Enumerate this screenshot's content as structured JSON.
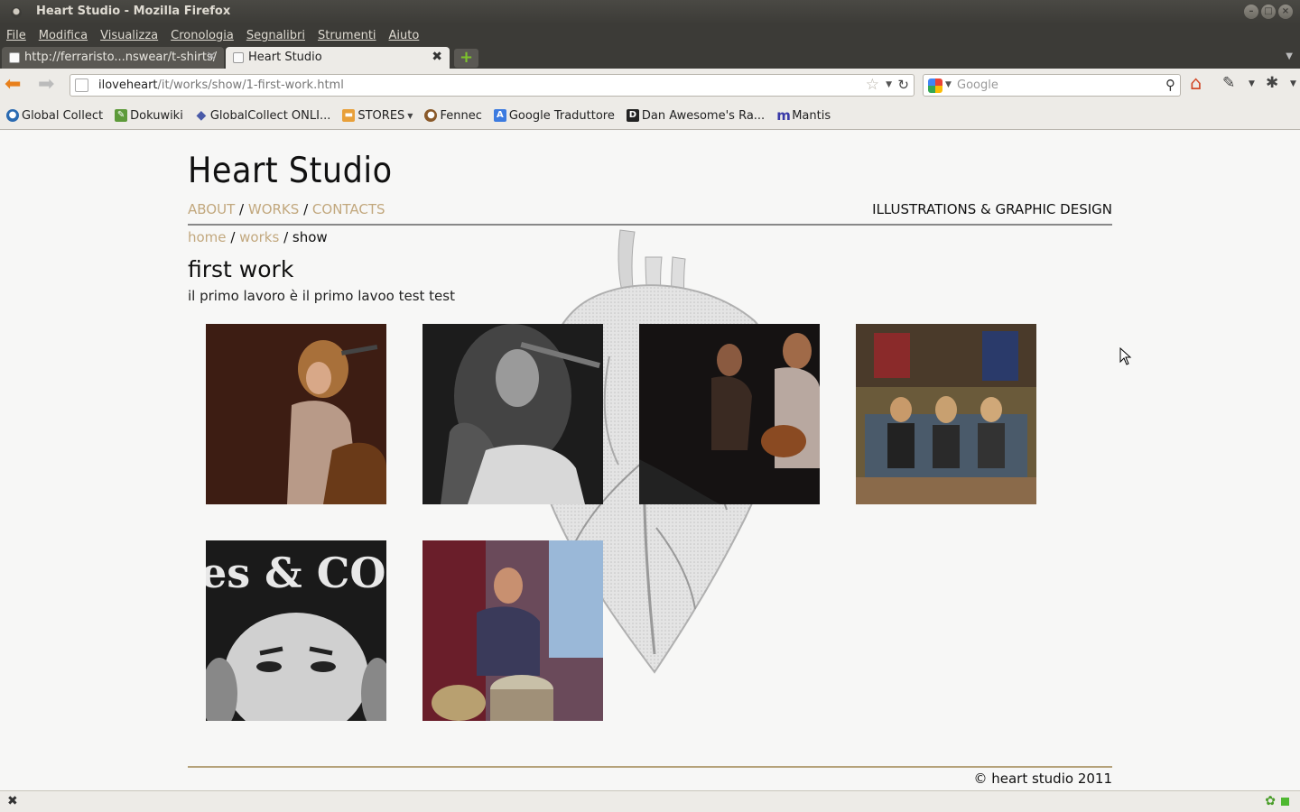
{
  "window": {
    "title": "Heart Studio - Mozilla Firefox"
  },
  "menubar": {
    "items": [
      "File",
      "Modifica",
      "Visualizza",
      "Cronologia",
      "Segnalibri",
      "Strumenti",
      "Aiuto"
    ]
  },
  "tabs": [
    {
      "label": "http://ferraristo...nswear/t-shirts/",
      "active": false
    },
    {
      "label": "Heart Studio",
      "active": true
    }
  ],
  "navbar": {
    "url_host": "iloveheart",
    "url_path": "/it/works/show/1-first-work.html",
    "search_placeholder": "Google"
  },
  "bookmarks": [
    {
      "label": "Global Collect",
      "icon": "globe-icon"
    },
    {
      "label": "Dokuwiki",
      "icon": "wiki-icon"
    },
    {
      "label": "GlobalCollect ONLI...",
      "icon": "diamond-icon"
    },
    {
      "label": "STORES",
      "icon": "folder-icon"
    },
    {
      "label": "Fennec",
      "icon": "fennec-icon"
    },
    {
      "label": "Google Traduttore",
      "icon": "translate-icon"
    },
    {
      "label": "Dan Awesome's Ra...",
      "icon": "d-icon"
    },
    {
      "label": "Mantis",
      "icon": "mantis-icon"
    }
  ],
  "page": {
    "site_title": "Heart Studio",
    "nav": {
      "about": "ABOUT",
      "works": "WORKS",
      "contacts": "CONTACTS",
      "sep": "/"
    },
    "tagline": "ILLUSTRATIONS & GRAPHIC DESIGN",
    "breadcrumb": {
      "home": "home",
      "works": "works",
      "current": "show",
      "sep": "/"
    },
    "work_title": "first work",
    "work_description": "il primo lavoro è il primo lavoo test test",
    "thumbnail_texts": {
      "band_logo": "es & COMP"
    },
    "copyright": "© heart studio 2011"
  },
  "colors": {
    "link": "#c2a87e",
    "chrome_dark": "#3c3b37",
    "chrome_light": "#edebe7",
    "page_bg": "#f7f7f6"
  }
}
